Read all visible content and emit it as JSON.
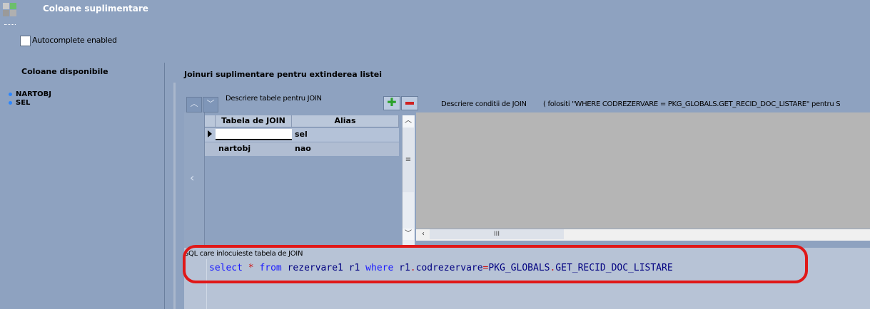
{
  "header": {
    "title": "Coloane suplimentare"
  },
  "autocomplete": {
    "label": "Autocomplete enabled",
    "checked": false
  },
  "available_columns": {
    "title": "Coloane disponibile",
    "items": [
      "NARTOBJ",
      "SEL"
    ]
  },
  "joins": {
    "title": "Joinuri suplimentare pentru extinderea listei",
    "table_desc_label": "Descriere tabele pentru JOIN",
    "condition_label": "Descriere conditii de JOIN",
    "condition_hint": "( folositi \"WHERE CODREZERVARE = PKG_GLOBALS.GET_RECID_DOC_LISTARE\" pentru S",
    "columns": [
      "Tabela de JOIN",
      "Alias"
    ],
    "rows": [
      {
        "table": "",
        "alias": "sel"
      },
      {
        "table": "nartobj",
        "alias": "nao"
      }
    ],
    "scroll_thumb_glyph": "≡",
    "hscroll_thumb_glyph": "III"
  },
  "sql": {
    "label": "SQL care inlocuieste tabela de JOIN",
    "tokens": {
      "t1": "select",
      "t2": "*",
      "t3": "from",
      "t4": "rezervare1 r1",
      "t5": "where",
      "t6": "r1",
      "t7": ".",
      "t8": "codrezervare",
      "t9": "=",
      "t10": "PKG_GLOBALS",
      "t11": ".",
      "t12": "GET_RECID_DOC_LISTARE"
    }
  },
  "colors": {
    "background": "#8ea2c0",
    "highlight": "#e01818"
  }
}
